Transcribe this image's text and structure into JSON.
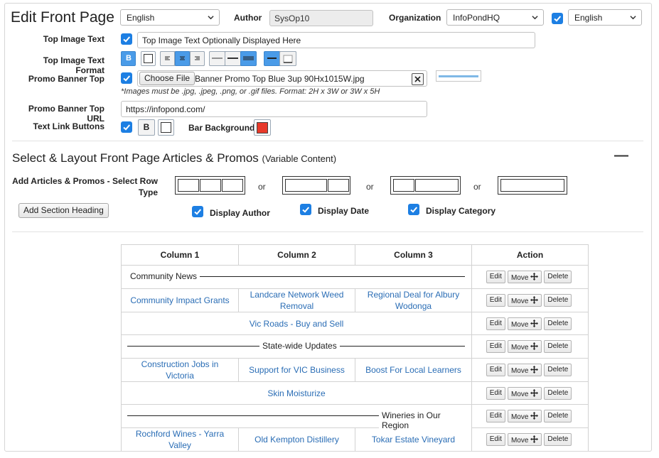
{
  "page": {
    "title": "Edit Front Page"
  },
  "header": {
    "language_value": "English",
    "author_label": "Author",
    "author_value": "SysOp10",
    "organization_label": "Organization",
    "organization_value": "InfoPondHQ",
    "language2_value": "English"
  },
  "form": {
    "top_image_text_label": "Top Image Text",
    "top_image_text_value": "Top Image Text Optionally Displayed Here",
    "top_image_text_format_label": "Top Image Text Format",
    "bold_label": "B",
    "promo_banner_top_label": "Promo Banner Top",
    "choose_file_label": "Choose File",
    "file_name": "Banner Promo Top Blue 3up 90Hx1015W.jpg",
    "image_hint": "*Images must be .jpg, .jpeg, .png, or .gif files. Format: 2H x 3W or 3W x 5H",
    "promo_banner_top_url_label": "Promo Banner Top URL",
    "promo_banner_top_url_value": "https://infopond.com/",
    "text_link_buttons_label": "Text Link Buttons",
    "bar_background_label": "Bar Background",
    "bar_background_color": "#e8392a"
  },
  "layout": {
    "section_title": "Select & Layout Front Page Articles & Promos",
    "section_subtitle": "(Variable Content)",
    "collapse_glyph": "—",
    "add_row_label_1": "Add Articles & Promos - Select Row",
    "add_row_label_2": "Type",
    "or_label": "or",
    "add_section_heading": "Add Section Heading",
    "display_author": "Display Author",
    "display_date": "Display Date",
    "display_category": "Display Category"
  },
  "table": {
    "headers": [
      "Column 1",
      "Column 2",
      "Column 3",
      "Action"
    ],
    "actions": {
      "edit": "Edit",
      "move": "Move",
      "delete": "Delete"
    },
    "rows": [
      {
        "type": "heading",
        "align": "left",
        "text": "Community News"
      },
      {
        "type": "three",
        "cells": [
          "Community Impact Grants",
          "Landcare Network Weed Removal",
          "Regional Deal for Albury Wodonga"
        ]
      },
      {
        "type": "single",
        "text": "Vic Roads - Buy and Sell"
      },
      {
        "type": "heading",
        "align": "center",
        "text": "State-wide Updates"
      },
      {
        "type": "three",
        "cells": [
          "Construction Jobs in Victoria",
          "Support for VIC Business",
          "Boost For Local Learners"
        ]
      },
      {
        "type": "single",
        "text": "Skin Moisturize"
      },
      {
        "type": "heading",
        "align": "right",
        "text": "Wineries in Our Region"
      },
      {
        "type": "three",
        "cells": [
          "Rochford Wines - Yarra Valley",
          "Old Kempton Distillery",
          "Tokar Estate Vineyard"
        ]
      }
    ]
  },
  "colors": {
    "accent": "#1d7fe3",
    "link": "#2a6db5"
  }
}
